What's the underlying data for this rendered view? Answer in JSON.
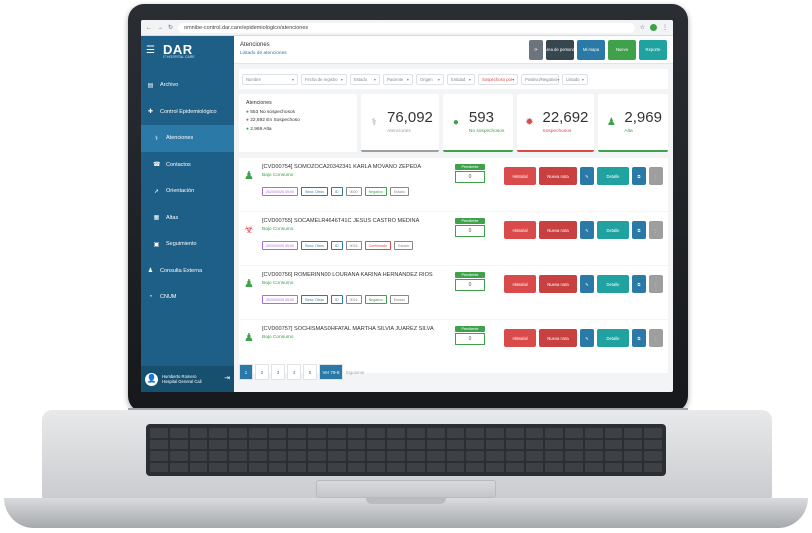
{
  "browser": {
    "url": "omnibe-control.dar.care/epidemiologico/atenciones"
  },
  "app": {
    "brand": "DAR",
    "brand_sub": "IT HOSPITAL CARE",
    "accent": "#1d5f86"
  },
  "sidebar": {
    "items": [
      {
        "label": "Archivo",
        "icon": "folder-icon"
      },
      {
        "label": "Control Epidemiológico",
        "icon": "shield-icon"
      },
      {
        "label": "Atenciones",
        "icon": "stethoscope-icon"
      },
      {
        "label": "Contactos",
        "icon": "phone-icon"
      },
      {
        "label": "Orientación",
        "icon": "direction-icon"
      },
      {
        "label": "Altas",
        "icon": "document-icon"
      },
      {
        "label": "Seguimiento",
        "icon": "calendar-icon"
      },
      {
        "label": "Consulta Externa",
        "icon": "person-icon"
      },
      {
        "label": "CNUM",
        "icon": "chart-icon"
      }
    ],
    "user": {
      "name": "Humberto Romero",
      "org": "Hospital General Cali"
    }
  },
  "header": {
    "title": "Atenciones",
    "subtitle": "Listado de atenciones"
  },
  "toolbar": {
    "buttons": [
      {
        "label": "⟳",
        "color": "#6c757d"
      },
      {
        "label": "Area de personal",
        "color": "#37474f"
      },
      {
        "label": "Mi mapa",
        "color": "#2a79a7"
      },
      {
        "label": "Nuevo",
        "color": "#3fa14a"
      },
      {
        "label": "Reporte",
        "color": "#1fa2a0"
      }
    ]
  },
  "filters": [
    {
      "label": "Nombre"
    },
    {
      "label": "Fecha de registro"
    },
    {
      "label": "Estado"
    },
    {
      "label": "Paciente"
    },
    {
      "label": "Origen"
    },
    {
      "label": "Entidad"
    },
    {
      "label": "Sospechoso por"
    },
    {
      "label": "Positivo/Negativo"
    },
    {
      "label": "Listado"
    }
  ],
  "summary": {
    "title": "Atenciones",
    "lines": [
      "553 No sospechosos",
      "22,692 En Sospechoso",
      "2,969 Alta"
    ]
  },
  "stats": [
    {
      "value": "76,092",
      "label": "Atenciones",
      "color": "#9e9e9e",
      "icon": "stethoscope-icon"
    },
    {
      "value": "593",
      "label": "No sospechosos",
      "color": "#3fa14a",
      "icon": "circle-icon"
    },
    {
      "value": "22,692",
      "label": "Sospechosos",
      "color": "#d94b4b",
      "icon": "virus-icon"
    },
    {
      "value": "2,969",
      "label": "Alta",
      "color": "#3fa14a",
      "icon": "user-icon"
    }
  ],
  "rows": [
    {
      "title": "[CVD00754] SOMOZOCA20342341 KARLA MOVANO ZEPEDA",
      "status": "Bajo Consumo",
      "icon_color": "#3fa14a",
      "tags": [
        "2020/03/26 05:00",
        "Sexo: Otros",
        "ID",
        "0000",
        "Negativo",
        "Estado"
      ],
      "badge": "Pendiente",
      "count": "0"
    },
    {
      "title": "[CVD00755] SOCAMELR4646T41C JESUS CASTRO MEDINA",
      "status": "Bajo Consumo",
      "icon_color": "#d94b4b",
      "tags": [
        "2020/03/26 05:00",
        "Sexo: Otros",
        "ID",
        "0016",
        "Confirmado",
        "Estado"
      ],
      "badge": "Pendiente",
      "count": "0"
    },
    {
      "title": "[CVD00756] ROMERINN00 LOURANA KARINA HERNÁNDEZ RIOS",
      "status": "Bajo Consumo",
      "icon_color": "#3fa14a",
      "tags": [
        "2020/03/26 05:00",
        "Sexo: Otros",
        "ID",
        "0016",
        "Negativo",
        "Estado"
      ],
      "badge": "Pendiente",
      "count": "0"
    },
    {
      "title": "[CVD00757] SOCHISMAS0HFATAL MARTHA SILVIA JUÁREZ SILVA",
      "status": "Bajo Consumo",
      "icon_color": "#3fa14a",
      "tags": [],
      "badge": "Pendiente",
      "count": "0"
    }
  ],
  "actions": {
    "historial": "Historial",
    "nueva_nota": "Nueva nota",
    "detalle": "Detalle"
  },
  "pager": {
    "pages": [
      "1",
      "2",
      "3",
      "4",
      "5"
    ],
    "next": "Ver 79-8",
    "extra": "Siguiente"
  }
}
